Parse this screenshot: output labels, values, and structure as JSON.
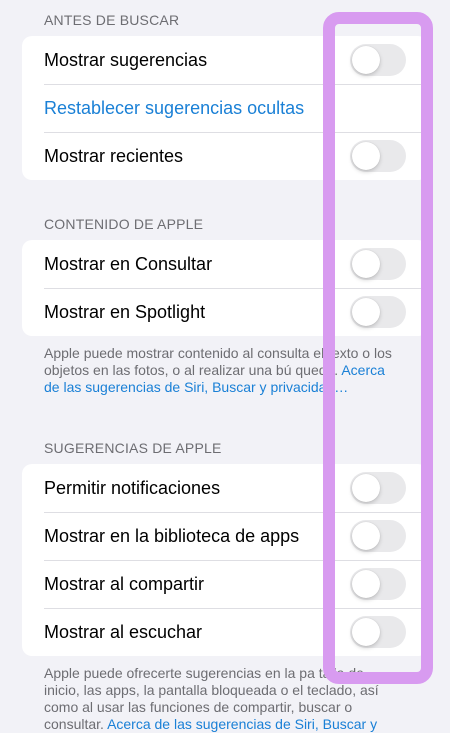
{
  "sections": {
    "before_search": {
      "header": "ANTES DE BUSCAR",
      "rows": [
        {
          "label": "Mostrar sugerencias",
          "toggle": false
        },
        {
          "label": "Restablecer sugerencias ocultas",
          "link": true
        },
        {
          "label": "Mostrar recientes",
          "toggle": false
        }
      ]
    },
    "apple_content": {
      "header": "CONTENIDO DE APPLE",
      "rows": [
        {
          "label": "Mostrar en Consultar",
          "toggle": false
        },
        {
          "label": "Mostrar en Spotlight",
          "toggle": false
        }
      ],
      "footer_text": "Apple puede mostrar contenido al consulta  el texto o los objetos en las fotos, o al realizar una bú queda.",
      "footer_link": "Acerca de las sugerencias de Siri, Buscar y privacidad…"
    },
    "apple_suggestions": {
      "header": "SUGERENCIAS DE APPLE",
      "rows": [
        {
          "label": "Permitir notificaciones",
          "toggle": false
        },
        {
          "label": "Mostrar en la biblioteca de apps",
          "toggle": false
        },
        {
          "label": "Mostrar al compartir",
          "toggle": false
        },
        {
          "label": "Mostrar al escuchar",
          "toggle": false
        }
      ],
      "footer_text": "Apple puede ofrecerte sugerencias en la pa talla de inicio, las apps, la pantalla bloqueada o el teclado, así como al usar las funciones de compartir, buscar o consultar.",
      "footer_link": "Acerca de las sugerencias de Siri, Buscar y"
    }
  },
  "colors": {
    "link": "#1a80d6",
    "switch_off": "#e9e9eb",
    "highlight": "#d89bf0"
  }
}
